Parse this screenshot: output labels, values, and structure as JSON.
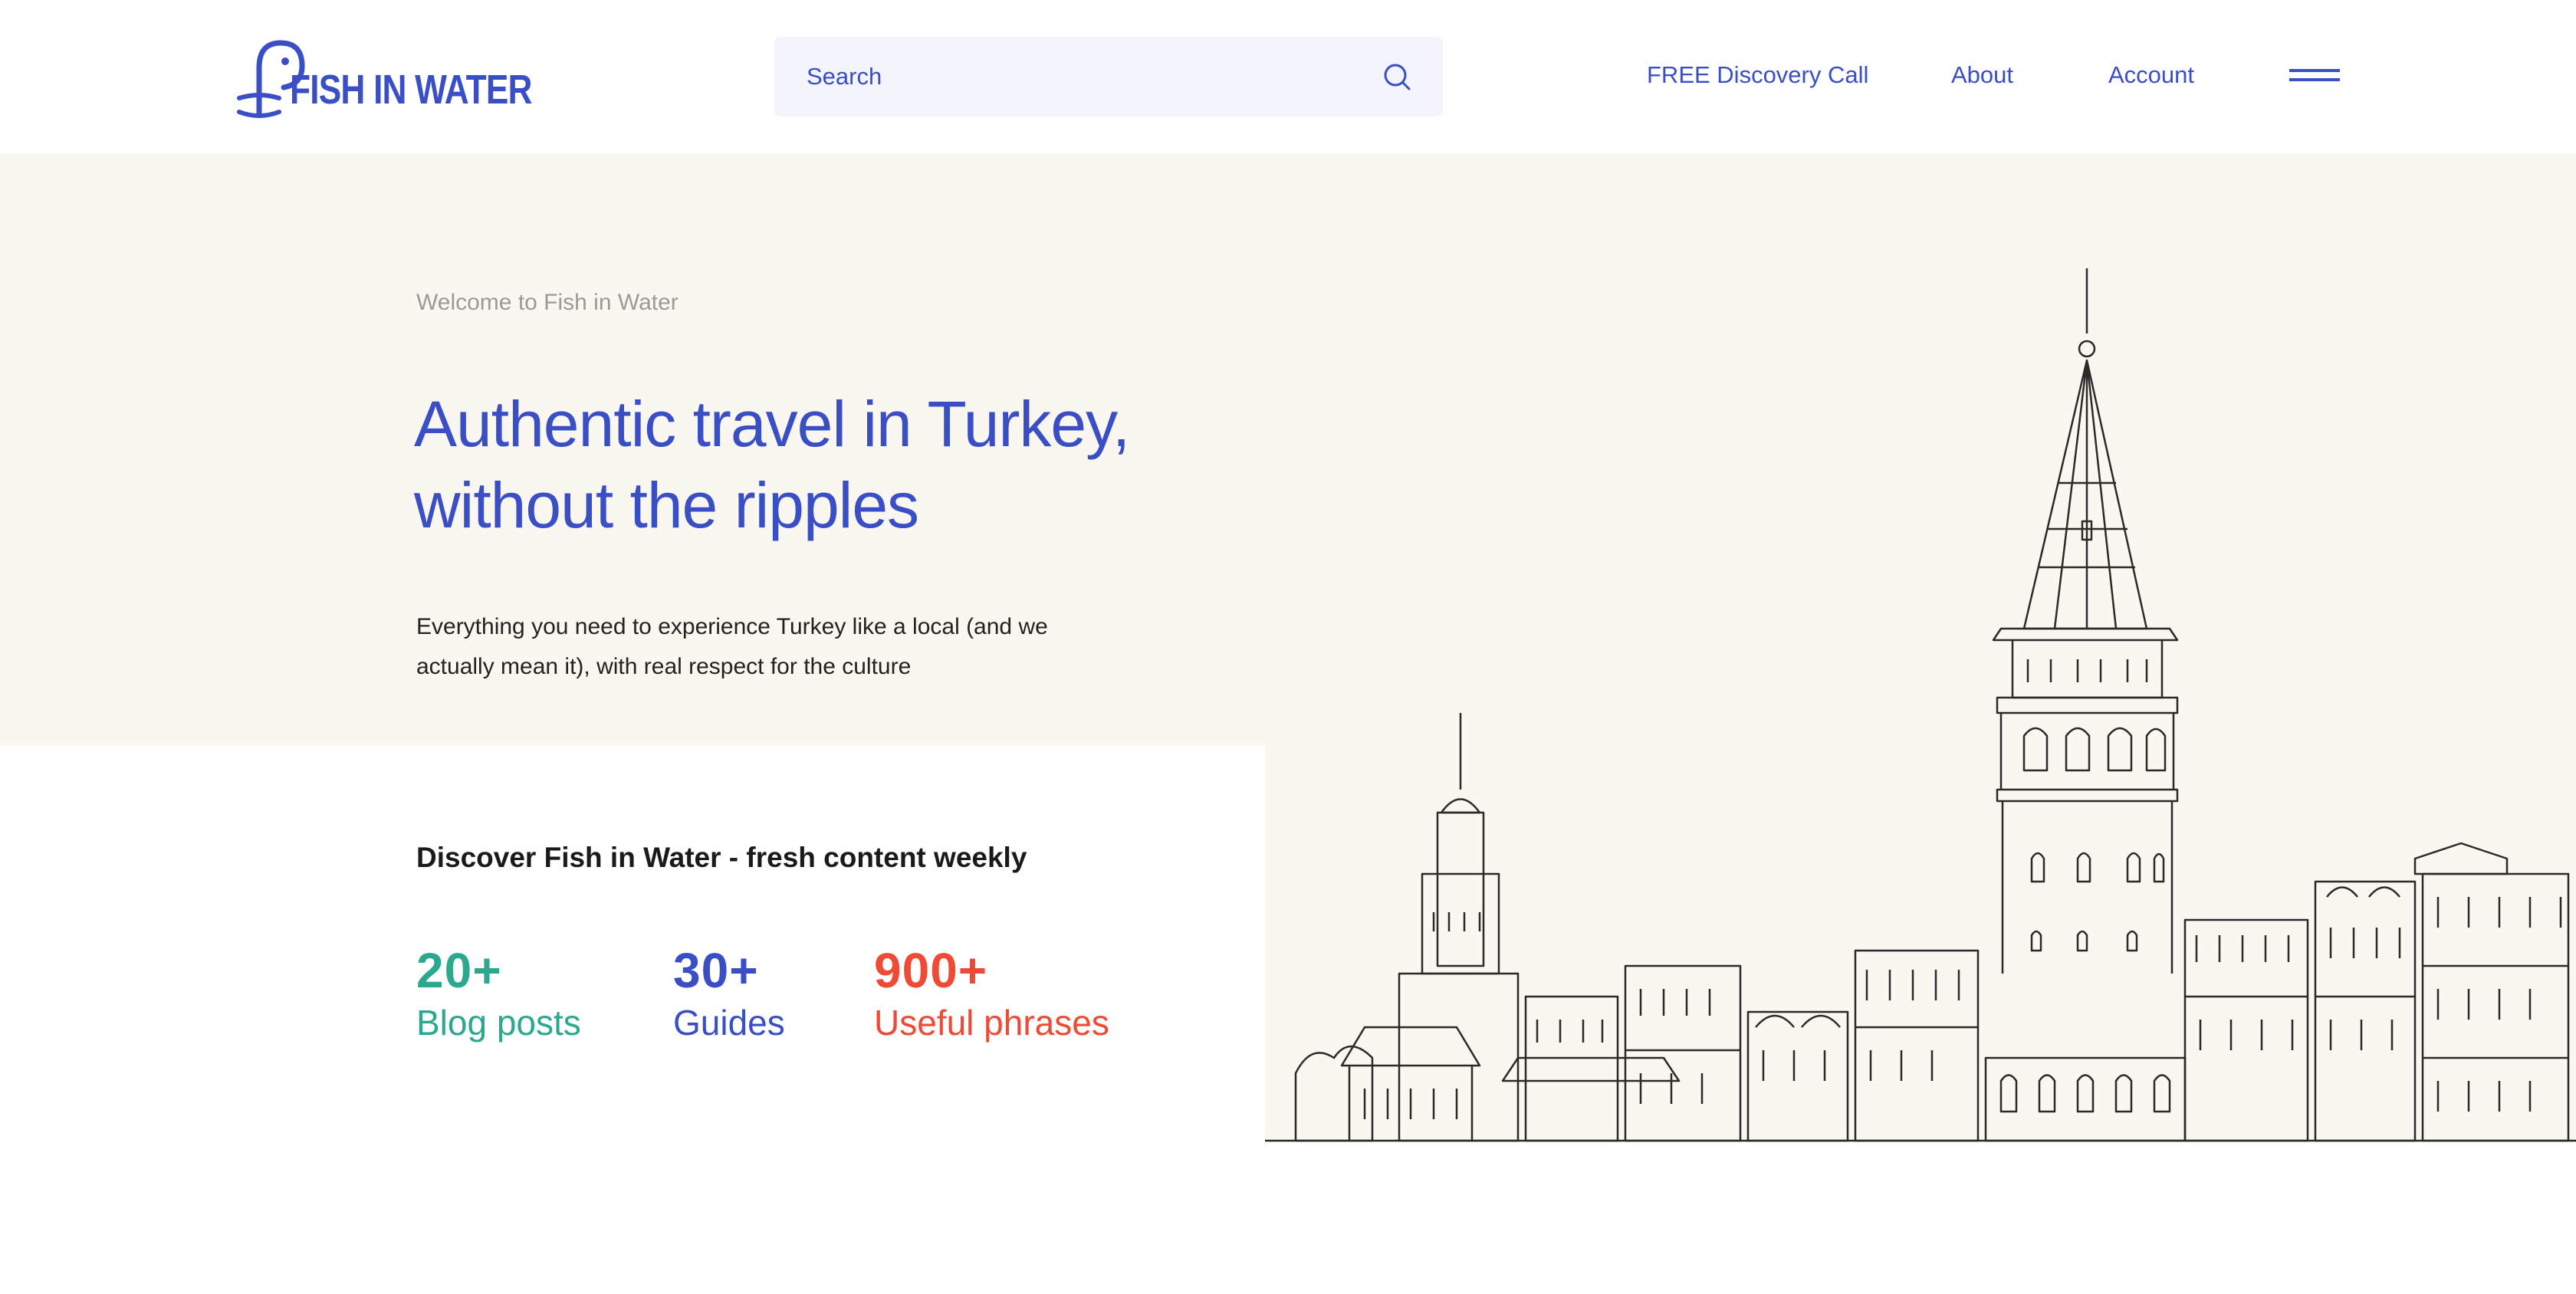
{
  "header": {
    "logo_text": "FISH IN WATER",
    "search": {
      "placeholder": "Search"
    },
    "nav": {
      "discovery": "FREE Discovery Call",
      "about": "About",
      "account": "Account"
    }
  },
  "hero": {
    "welcome": "Welcome to Fish in Water",
    "headline": "Authentic travel in Turkey, without the ripples",
    "description": "Everything you need to experience Turkey like a local (and we actually mean it), with real respect for the culture"
  },
  "stats": {
    "title": "Discover Fish in Water - fresh content weekly",
    "items": [
      {
        "number": "20+",
        "label": "Blog posts",
        "color": "#2aa98f"
      },
      {
        "number": "30+",
        "label": "Guides",
        "color": "#3a4fc6"
      },
      {
        "number": "900+",
        "label": "Useful phrases",
        "color": "#ef4a36"
      }
    ]
  },
  "colors": {
    "brand": "#3a4fc6",
    "hero_bg": "#faf6f0",
    "search_bg": "#f3f4fc"
  },
  "icons": [
    "fish-logo-icon",
    "search-icon",
    "hamburger-menu-icon"
  ]
}
